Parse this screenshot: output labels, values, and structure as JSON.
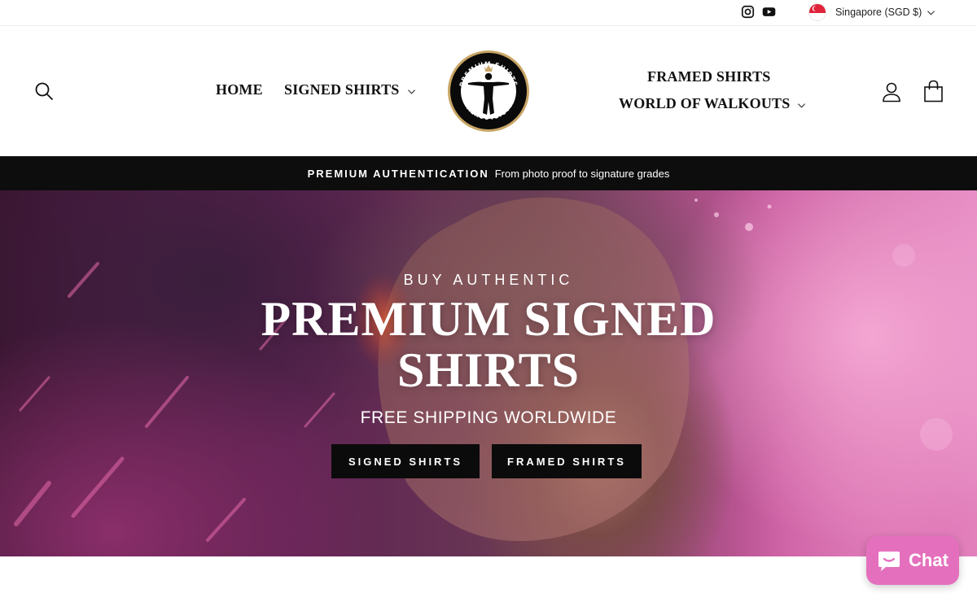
{
  "utility": {
    "social": [
      {
        "icon": "instagram-icon"
      },
      {
        "icon": "youtube-icon"
      }
    ],
    "currency": {
      "label": "Singapore (SGD $)",
      "flag": "singapore-flag-icon"
    }
  },
  "header": {
    "nav_left": [
      {
        "label": "HOME",
        "has_dropdown": false
      },
      {
        "label": "SIGNED SHIRTS",
        "has_dropdown": true
      }
    ],
    "nav_right": [
      {
        "label": "FRAMED SHIRTS",
        "has_dropdown": false
      },
      {
        "label": "WORLD OF WALKOUTS",
        "has_dropdown": true
      }
    ],
    "logo": {
      "top_text": "PREMIUM SHIRTS",
      "bottom_text": "WALKOUTS.COM"
    },
    "icons": [
      "search-icon",
      "account-icon",
      "cart-icon"
    ]
  },
  "announcement": {
    "strong": "PREMIUM AUTHENTICATION",
    "text": "From photo proof to signature grades"
  },
  "hero": {
    "eyebrow": "BUY AUTHENTIC",
    "title_line1": "PREMIUM SIGNED",
    "title_line2": "SHIRTS",
    "subtitle": "FREE SHIPPING WORLDWIDE",
    "buttons": [
      {
        "label": "SIGNED SHIRTS"
      },
      {
        "label": "FRAMED SHIRTS"
      }
    ]
  },
  "chat": {
    "label": "Chat"
  },
  "colors": {
    "announcement_bg": "#0d0d0d",
    "button_bg": "#0b0b0b",
    "chat_bg": "#e470bd",
    "logo_ring": "#c8a565",
    "hero_pink": "#e58bc4"
  }
}
